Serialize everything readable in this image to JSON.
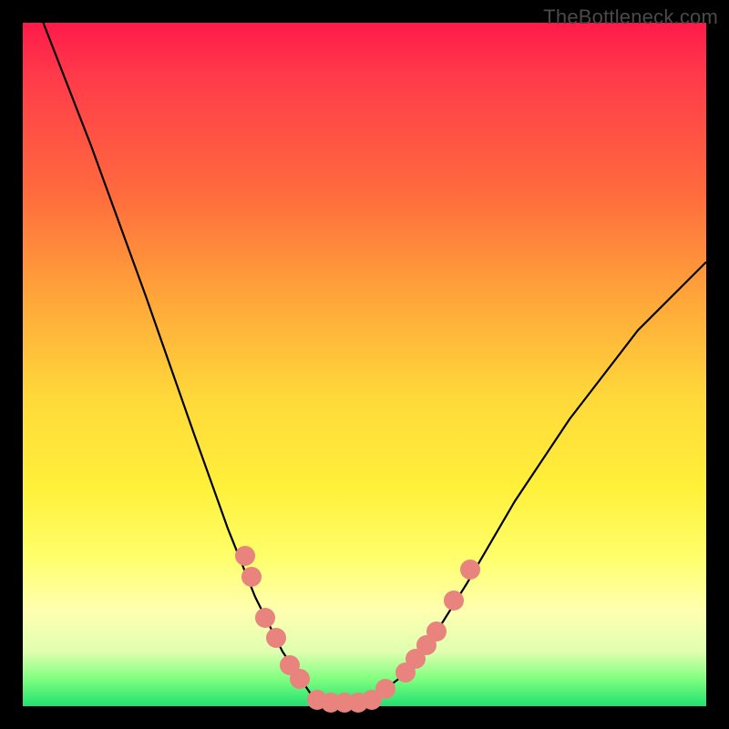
{
  "watermark": "TheBottleneck.com",
  "chart_data": {
    "type": "line",
    "title": "",
    "xlabel": "",
    "ylabel": "",
    "xlim": [
      0,
      100
    ],
    "ylim": [
      0,
      100
    ],
    "curve": {
      "description": "V-shaped bottleneck curve; y is mismatch %, minimum near x≈47",
      "points": [
        {
          "x": 3,
          "y": 100
        },
        {
          "x": 10,
          "y": 82
        },
        {
          "x": 18,
          "y": 60
        },
        {
          "x": 25,
          "y": 40
        },
        {
          "x": 30,
          "y": 26
        },
        {
          "x": 34,
          "y": 16
        },
        {
          "x": 38,
          "y": 8
        },
        {
          "x": 42,
          "y": 2
        },
        {
          "x": 45,
          "y": 0.5
        },
        {
          "x": 48,
          "y": 0.5
        },
        {
          "x": 51,
          "y": 1
        },
        {
          "x": 55,
          "y": 4
        },
        {
          "x": 60,
          "y": 10
        },
        {
          "x": 65,
          "y": 18
        },
        {
          "x": 72,
          "y": 30
        },
        {
          "x": 80,
          "y": 42
        },
        {
          "x": 90,
          "y": 55
        },
        {
          "x": 100,
          "y": 65
        }
      ]
    },
    "markers": [
      {
        "x": 32.5,
        "y": 22
      },
      {
        "x": 33.5,
        "y": 19
      },
      {
        "x": 35.5,
        "y": 13
      },
      {
        "x": 37,
        "y": 10
      },
      {
        "x": 39,
        "y": 6
      },
      {
        "x": 40.5,
        "y": 4
      },
      {
        "x": 43,
        "y": 1
      },
      {
        "x": 45,
        "y": 0.5
      },
      {
        "x": 47,
        "y": 0.5
      },
      {
        "x": 49,
        "y": 0.5
      },
      {
        "x": 51,
        "y": 1
      },
      {
        "x": 53,
        "y": 2.5
      },
      {
        "x": 56,
        "y": 5
      },
      {
        "x": 57.5,
        "y": 7
      },
      {
        "x": 59,
        "y": 9
      },
      {
        "x": 60.5,
        "y": 11
      },
      {
        "x": 63,
        "y": 15.5
      },
      {
        "x": 65.5,
        "y": 20
      }
    ]
  }
}
